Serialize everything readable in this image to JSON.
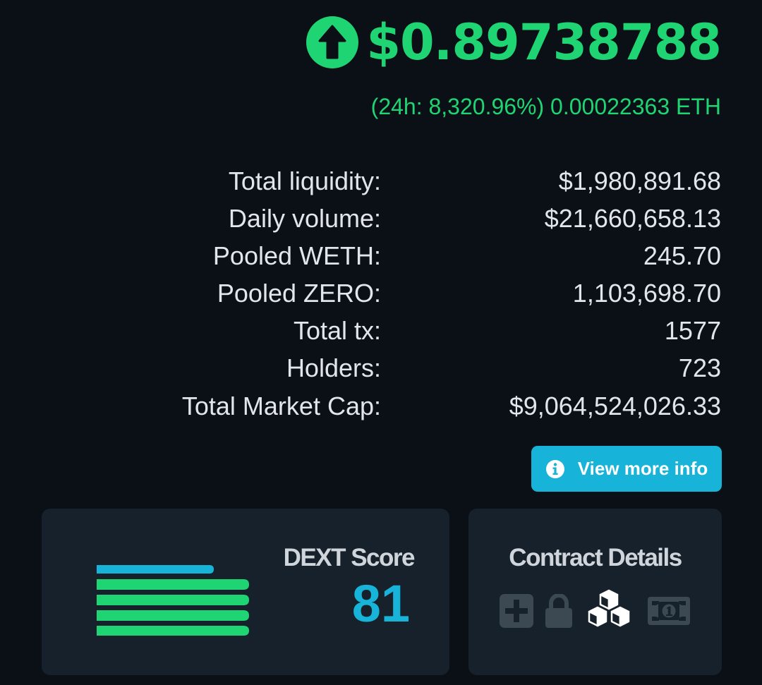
{
  "price": {
    "value": "$0.89738788",
    "change_text": "(24h: 8,320.96%) 0.00022363 ETH",
    "direction_icon": "arrow-up-circle-icon"
  },
  "stats": [
    {
      "label": "Total liquidity:",
      "value": "$1,980,891.68"
    },
    {
      "label": "Daily volume:",
      "value": "$21,660,658.13"
    },
    {
      "label": "Pooled WETH:",
      "value": "245.70"
    },
    {
      "label": "Pooled ZERO:",
      "value": "1,103,698.70"
    },
    {
      "label": "Total tx:",
      "value": "1577"
    },
    {
      "label": "Holders:",
      "value": "723"
    },
    {
      "label": "Total Market Cap:",
      "value": "$9,064,524,026.33"
    }
  ],
  "info_button": {
    "label": "View more info",
    "icon": "info-icon"
  },
  "dext_score": {
    "title": "DEXT Score",
    "value": "81",
    "bars_icon": "score-bars-icon"
  },
  "contract_details": {
    "title": "Contract Details",
    "icons": [
      "plus-square-icon",
      "lock-icon",
      "cubes-icon",
      "banknote-icon"
    ]
  },
  "colors": {
    "background": "#0a1016",
    "card": "#16212b",
    "positive": "#1fd573",
    "accent": "#17b3d8",
    "muted_icon": "#3c4852",
    "text": "#e2e6ea",
    "heading": "#cfd5da"
  }
}
